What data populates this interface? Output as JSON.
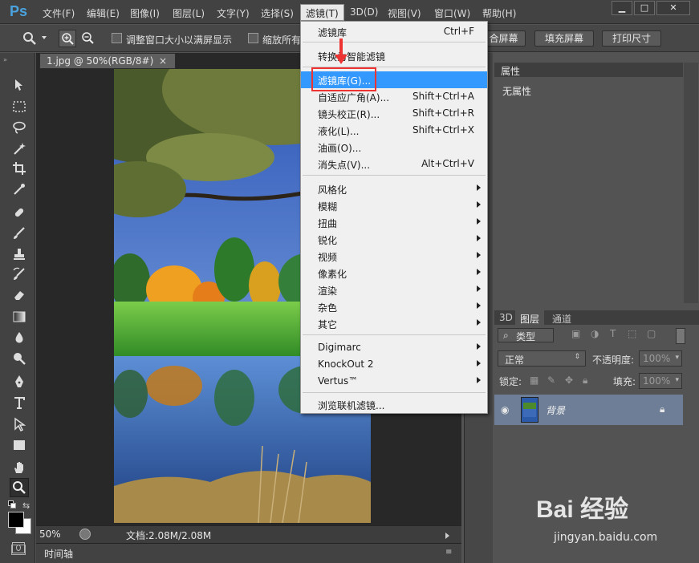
{
  "app": {
    "logo": "Ps"
  },
  "menubar": {
    "items": [
      "文件(F)",
      "编辑(E)",
      "图像(I)",
      "图层(L)",
      "文字(Y)",
      "选择(S)",
      "滤镜(T)",
      "3D(D)",
      "视图(V)",
      "窗口(W)",
      "帮助(H)"
    ]
  },
  "optionsbar": {
    "resize_windows_label": "调整窗口大小以满屏显示",
    "zoom_all_label": "缩放所有",
    "fit_screen_label": "合屏幕",
    "fill_screen_label": "填充屏幕",
    "print_size_label": "打印尺寸"
  },
  "document": {
    "tab_title": "1.jpg @ 50%(RGB/8#)",
    "zoom": "50%",
    "doc_size": "文档:2.08M/2.08M",
    "timeline_label": "时间轴"
  },
  "filter_menu": {
    "last_filter": {
      "label": "滤镜库",
      "shortcut": "Ctrl+F"
    },
    "convert_smart": {
      "label": "转换为智能滤镜"
    },
    "items_top": [
      {
        "label": "滤镜库(G)...",
        "shortcut": ""
      },
      {
        "label": "自适应广角(A)...",
        "shortcut": "Shift+Ctrl+A"
      },
      {
        "label": "镜头校正(R)...",
        "shortcut": "Shift+Ctrl+R"
      },
      {
        "label": "液化(L)...",
        "shortcut": "Shift+Ctrl+X"
      },
      {
        "label": "油画(O)...",
        "shortcut": ""
      },
      {
        "label": "消失点(V)...",
        "shortcut": "Alt+Ctrl+V"
      }
    ],
    "submenus": [
      "风格化",
      "模糊",
      "扭曲",
      "锐化",
      "视频",
      "像素化",
      "渲染",
      "杂色",
      "其它"
    ],
    "plugins": [
      "Digimarc",
      "KnockOut 2",
      "Vertus™"
    ],
    "browse_online": "浏览联机滤镜..."
  },
  "properties_panel": {
    "tab": "属性",
    "empty_text": "无属性"
  },
  "layers_panel": {
    "tabs": [
      "3D",
      "图层",
      "通道"
    ],
    "filter_kind": "类型",
    "blend_mode": "正常",
    "opacity_label": "不透明度:",
    "opacity_value": "100%",
    "lock_label": "锁定:",
    "fill_label": "填充:",
    "fill_value": "100%",
    "layer_name": "背景"
  },
  "watermark": {
    "brand": "Bai 经验",
    "url": "jingyan.baidu.com"
  },
  "colors": {
    "menu_highlight": "#3399ff",
    "annotation_red": "#ee3333",
    "ps_blue": "#4aa3df"
  }
}
